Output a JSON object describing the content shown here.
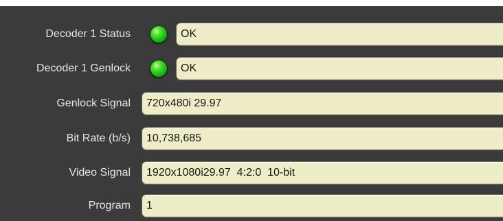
{
  "rows": [
    {
      "label": "Decoder 1 Status",
      "value": "OK",
      "indicator": {
        "icon": "green-led-icon",
        "color": "#22c21a"
      }
    },
    {
      "label": "Decoder 1 Genlock",
      "value": "OK",
      "indicator": {
        "icon": "green-led-icon",
        "color": "#22c21a"
      }
    },
    {
      "label": "Genlock Signal",
      "value": "720x480i 29.97"
    },
    {
      "label": "Bit Rate (b/s)",
      "value": "10,738,685"
    },
    {
      "label": "Video Signal",
      "value": "1920x1080i29.97  4:2:0  10-bit"
    },
    {
      "label": "Program",
      "value": "1"
    }
  ],
  "colors": {
    "panel_background": "#3b3b3b",
    "label_text": "#e6e6e6",
    "field_background": "#efedc8",
    "field_text": "#151515",
    "led_green": "#22c21a"
  }
}
